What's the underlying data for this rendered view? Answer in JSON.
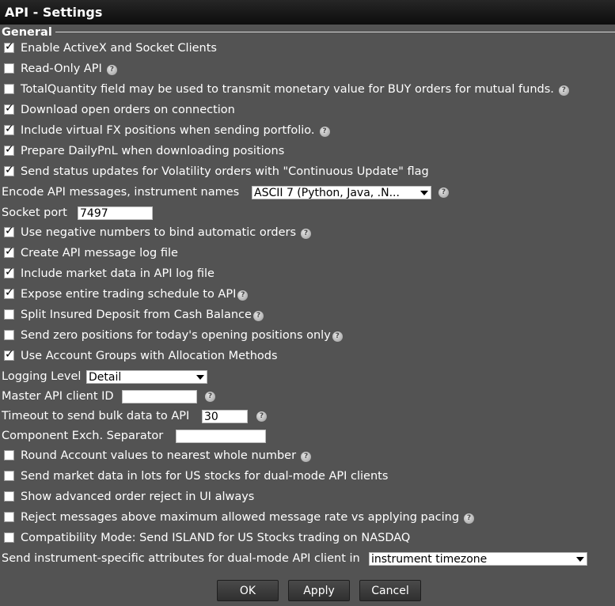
{
  "window": {
    "title": "API - Settings"
  },
  "section": {
    "label": "General"
  },
  "checks": {
    "activex": {
      "label": "Enable ActiveX and Socket Clients",
      "checked": true
    },
    "readonly": {
      "label": "Read-Only API",
      "checked": false
    },
    "totalqty": {
      "label": "TotalQuantity field may be used to transmit monetary value for BUY orders for mutual funds.",
      "checked": false
    },
    "download_orders": {
      "label": "Download open orders on connection",
      "checked": true
    },
    "virtual_fx": {
      "label": "Include virtual FX positions when sending portfolio.",
      "checked": true
    },
    "daily_pnl": {
      "label": "Prepare DailyPnL when downloading positions",
      "checked": true
    },
    "volatility": {
      "label": "Send status updates for Volatility orders with \"Continuous Update\" flag",
      "checked": true
    },
    "negative_numbers": {
      "label": "Use negative numbers to bind automatic orders",
      "checked": true
    },
    "log_file": {
      "label": "Create API message log file",
      "checked": true
    },
    "market_data_log": {
      "label": "Include market data in API log file",
      "checked": true
    },
    "trading_schedule": {
      "label": "Expose entire trading schedule to API",
      "checked": true
    },
    "insured_deposit": {
      "label": "Split Insured Deposit from Cash Balance",
      "checked": false
    },
    "zero_positions": {
      "label": "Send zero positions for today's opening positions only",
      "checked": false
    },
    "account_groups": {
      "label": "Use Account Groups with Allocation Methods",
      "checked": true
    },
    "round_values": {
      "label": "Round Account values to nearest whole number",
      "checked": false
    },
    "market_lots": {
      "label": "Send market data in lots for US stocks for dual-mode API clients",
      "checked": false
    },
    "order_reject": {
      "label": "Show advanced order reject in UI always",
      "checked": false
    },
    "reject_messages": {
      "label": "Reject messages above maximum allowed message rate vs applying pacing",
      "checked": false
    },
    "compat_mode": {
      "label": "Compatibility Mode: Send ISLAND for US Stocks trading on NASDAQ",
      "checked": false
    }
  },
  "encode": {
    "label": "Encode API messages, instrument names",
    "value": "ASCII 7 (Python, Java, .N..."
  },
  "socket_port": {
    "label": "Socket port",
    "value": "7497"
  },
  "logging": {
    "label": "Logging Level",
    "value": "Detail"
  },
  "master_client": {
    "label": "Master API client ID",
    "value": ""
  },
  "timeout": {
    "label": "Timeout to send bulk data to API",
    "value": "30"
  },
  "separator": {
    "label": "Component Exch. Separator",
    "value": ""
  },
  "instrument_attrs": {
    "label": "Send instrument-specific attributes for dual-mode API client in",
    "value": "instrument timezone"
  },
  "buttons": {
    "ok": "OK",
    "apply": "Apply",
    "cancel": "Cancel"
  },
  "icons": {
    "help": "help-icon",
    "check": "checkmark-icon",
    "dropdown": "dropdown-arrow-icon"
  },
  "colors": {
    "background": "#535353",
    "titlebar": "#1a1a1a",
    "text": "#ffffff"
  }
}
